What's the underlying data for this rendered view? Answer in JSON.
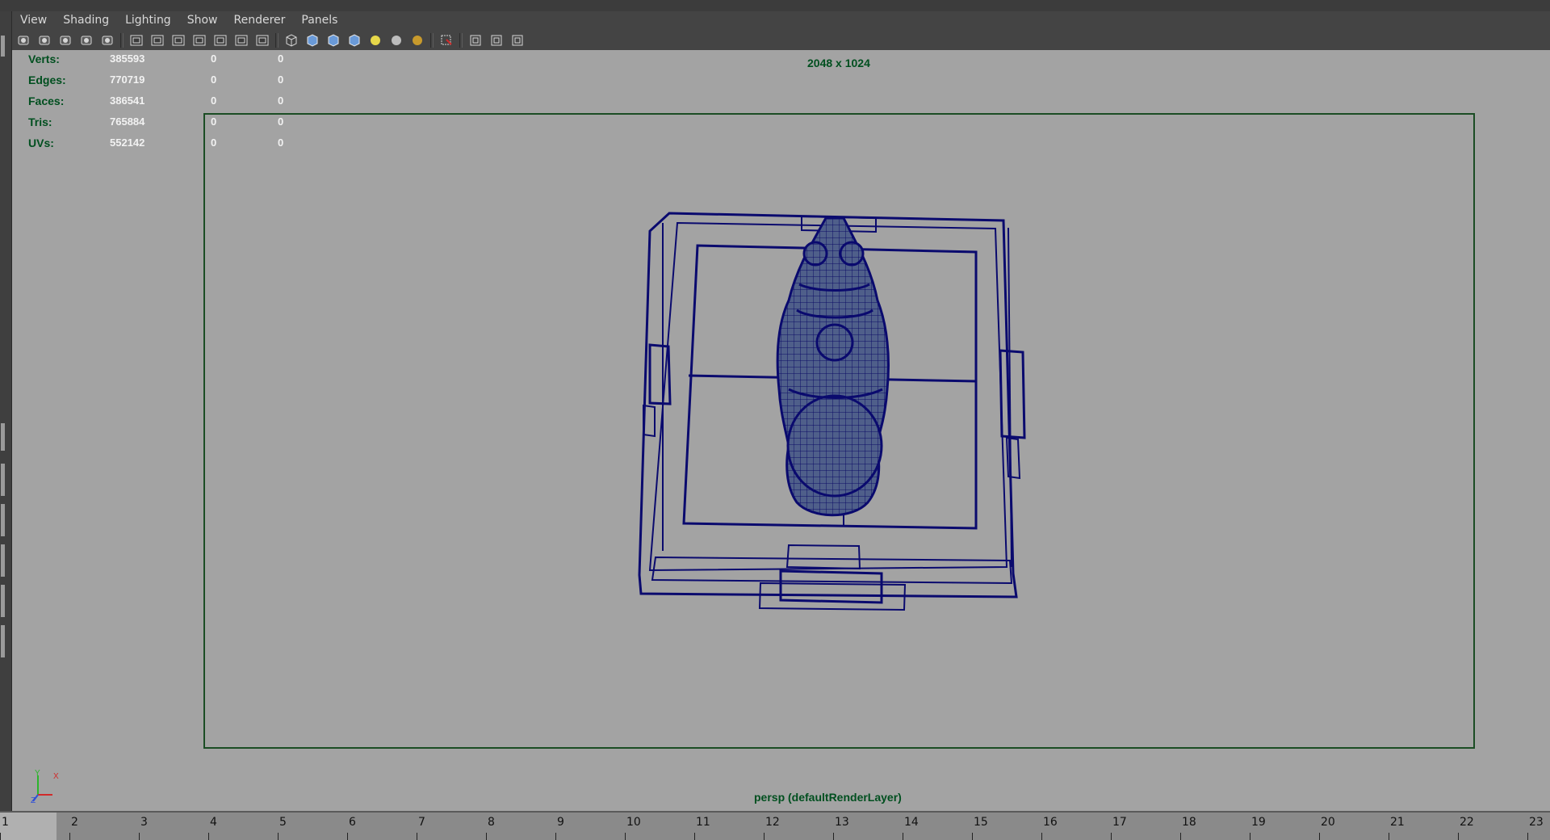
{
  "menu": [
    "View",
    "Shading",
    "Lighting",
    "Show",
    "Renderer",
    "Panels"
  ],
  "toolbar_icons": [
    "camera-icon",
    "camera-attributes-icon",
    "bookmark-icon",
    "image-plane-icon",
    "grease-pencil-icon",
    "sep",
    "grid-icon",
    "film-gate-icon",
    "resolution-gate-icon",
    "gate-mask-icon",
    "field-chart-icon",
    "safe-action-icon",
    "safe-title-icon",
    "sep",
    "wireframe-icon",
    "smooth-shade-icon",
    "wireframe-on-shaded-icon",
    "textured-icon",
    "use-all-lights-icon",
    "shadows-icon",
    "ambient-occlusion-icon",
    "sep",
    "isolate-select-icon",
    "sep",
    "xray-icon",
    "xray-joints-icon",
    "xray-components-icon"
  ],
  "hud_stats": [
    {
      "label": "Verts:",
      "v1": "385593",
      "v2": "0",
      "v3": "0"
    },
    {
      "label": "Edges:",
      "v1": "770719",
      "v2": "0",
      "v3": "0"
    },
    {
      "label": "Faces:",
      "v1": "386541",
      "v2": "0",
      "v3": "0"
    },
    {
      "label": "Tris:",
      "v1": "765884",
      "v2": "0",
      "v3": "0"
    },
    {
      "label": "UVs:",
      "v1": "552142",
      "v2": "0",
      "v3": "0"
    }
  ],
  "resolution_label": "2048 x 1024",
  "camera_label": "persp (defaultRenderLayer)",
  "axis": {
    "y": "Y",
    "x": "X",
    "z": "Z"
  },
  "timeline": [
    "1",
    "2",
    "3",
    "4",
    "5",
    "6",
    "7",
    "8",
    "9",
    "10",
    "11",
    "12",
    "13",
    "14",
    "15",
    "16",
    "17",
    "18",
    "19",
    "20",
    "21",
    "22",
    "23"
  ],
  "colors": {
    "hud_label": "#004f1f",
    "hud_value": "#f2f2f2",
    "wireframe": "#0a0a6e",
    "viewport_bg": "#a3a3a3"
  }
}
